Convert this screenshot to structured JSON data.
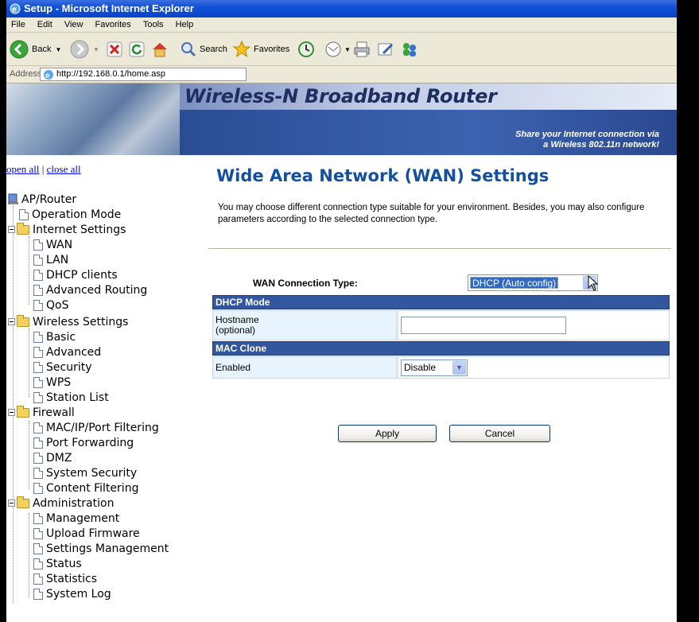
{
  "window": {
    "title": "Setup - Microsoft Internet Explorer",
    "menu": [
      "File",
      "Edit",
      "View",
      "Favorites",
      "Tools",
      "Help"
    ],
    "toolbar": {
      "back_label": "Back",
      "search_label": "Search",
      "favorites_label": "Favorites"
    },
    "address_label": "Address",
    "address_url": "http://192.168.0.1/home.asp"
  },
  "banner": {
    "title": "Wireless-N Broadband Router",
    "subtitle_line1": "Share your Internet connection via",
    "subtitle_line2": "a Wireless 802.11n network!"
  },
  "sidebar": {
    "open_all": "open all",
    "separator": "|",
    "close_all": "close all",
    "root": "AP/Router",
    "items": [
      {
        "label": "Operation Mode"
      },
      {
        "label": "Internet Settings",
        "children": [
          "WAN",
          "LAN",
          "DHCP clients",
          "Advanced Routing",
          "QoS"
        ]
      },
      {
        "label": "Wireless Settings",
        "children": [
          "Basic",
          "Advanced",
          "Security",
          "WPS",
          "Station List"
        ]
      },
      {
        "label": "Firewall",
        "children": [
          "MAC/IP/Port Filtering",
          "Port Forwarding",
          "DMZ",
          "System Security",
          "Content Filtering"
        ]
      },
      {
        "label": "Administration",
        "children": [
          "Management",
          "Upload Firmware",
          "Settings Management",
          "Status",
          "Statistics",
          "System Log"
        ]
      }
    ]
  },
  "main": {
    "title": "Wide Area Network (WAN) Settings",
    "description": "You may choose different connection type suitable for your environment. Besides, you may also configure parameters according to the selected connection type.",
    "connection_type_label": "WAN Connection Type:",
    "connection_type_value": "DHCP (Auto config)",
    "dhcp_header": "DHCP Mode",
    "hostname_label_line1": "Hostname",
    "hostname_label_line2": "(optional)",
    "hostname_value": "",
    "mac_header": "MAC Clone",
    "enabled_label": "Enabled",
    "enabled_value": "Disable",
    "apply_label": "Apply",
    "cancel_label": "Cancel"
  },
  "colors": {
    "title_blue": "#1450a0",
    "table_header": "#32579f",
    "label_cell": "#e8f4fd"
  }
}
